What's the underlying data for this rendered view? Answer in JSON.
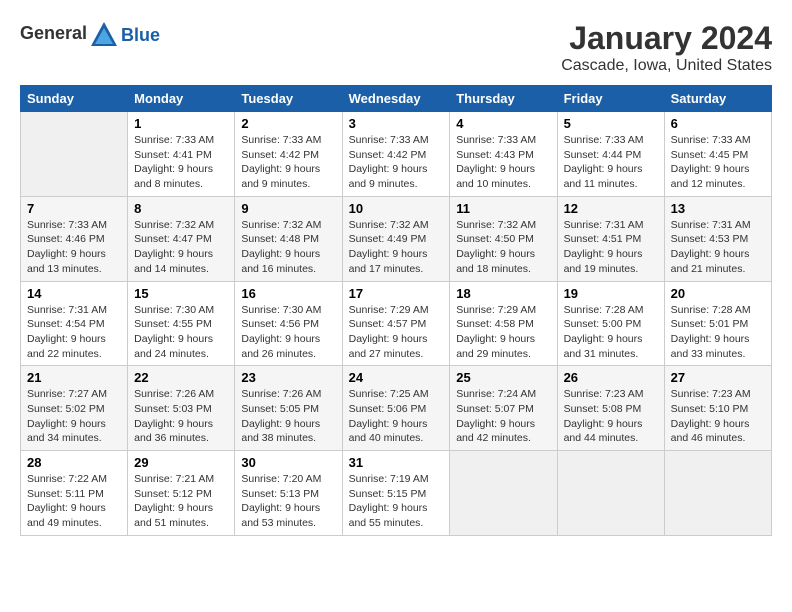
{
  "header": {
    "logo_general": "General",
    "logo_blue": "Blue",
    "month_year": "January 2024",
    "location": "Cascade, Iowa, United States"
  },
  "days_of_week": [
    "Sunday",
    "Monday",
    "Tuesday",
    "Wednesday",
    "Thursday",
    "Friday",
    "Saturday"
  ],
  "weeks": [
    [
      {
        "day": "",
        "info": ""
      },
      {
        "day": "1",
        "info": "Sunrise: 7:33 AM\nSunset: 4:41 PM\nDaylight: 9 hours\nand 8 minutes."
      },
      {
        "day": "2",
        "info": "Sunrise: 7:33 AM\nSunset: 4:42 PM\nDaylight: 9 hours\nand 9 minutes."
      },
      {
        "day": "3",
        "info": "Sunrise: 7:33 AM\nSunset: 4:42 PM\nDaylight: 9 hours\nand 9 minutes."
      },
      {
        "day": "4",
        "info": "Sunrise: 7:33 AM\nSunset: 4:43 PM\nDaylight: 9 hours\nand 10 minutes."
      },
      {
        "day": "5",
        "info": "Sunrise: 7:33 AM\nSunset: 4:44 PM\nDaylight: 9 hours\nand 11 minutes."
      },
      {
        "day": "6",
        "info": "Sunrise: 7:33 AM\nSunset: 4:45 PM\nDaylight: 9 hours\nand 12 minutes."
      }
    ],
    [
      {
        "day": "7",
        "info": "Sunrise: 7:33 AM\nSunset: 4:46 PM\nDaylight: 9 hours\nand 13 minutes."
      },
      {
        "day": "8",
        "info": "Sunrise: 7:32 AM\nSunset: 4:47 PM\nDaylight: 9 hours\nand 14 minutes."
      },
      {
        "day": "9",
        "info": "Sunrise: 7:32 AM\nSunset: 4:48 PM\nDaylight: 9 hours\nand 16 minutes."
      },
      {
        "day": "10",
        "info": "Sunrise: 7:32 AM\nSunset: 4:49 PM\nDaylight: 9 hours\nand 17 minutes."
      },
      {
        "day": "11",
        "info": "Sunrise: 7:32 AM\nSunset: 4:50 PM\nDaylight: 9 hours\nand 18 minutes."
      },
      {
        "day": "12",
        "info": "Sunrise: 7:31 AM\nSunset: 4:51 PM\nDaylight: 9 hours\nand 19 minutes."
      },
      {
        "day": "13",
        "info": "Sunrise: 7:31 AM\nSunset: 4:53 PM\nDaylight: 9 hours\nand 21 minutes."
      }
    ],
    [
      {
        "day": "14",
        "info": "Sunrise: 7:31 AM\nSunset: 4:54 PM\nDaylight: 9 hours\nand 22 minutes."
      },
      {
        "day": "15",
        "info": "Sunrise: 7:30 AM\nSunset: 4:55 PM\nDaylight: 9 hours\nand 24 minutes."
      },
      {
        "day": "16",
        "info": "Sunrise: 7:30 AM\nSunset: 4:56 PM\nDaylight: 9 hours\nand 26 minutes."
      },
      {
        "day": "17",
        "info": "Sunrise: 7:29 AM\nSunset: 4:57 PM\nDaylight: 9 hours\nand 27 minutes."
      },
      {
        "day": "18",
        "info": "Sunrise: 7:29 AM\nSunset: 4:58 PM\nDaylight: 9 hours\nand 29 minutes."
      },
      {
        "day": "19",
        "info": "Sunrise: 7:28 AM\nSunset: 5:00 PM\nDaylight: 9 hours\nand 31 minutes."
      },
      {
        "day": "20",
        "info": "Sunrise: 7:28 AM\nSunset: 5:01 PM\nDaylight: 9 hours\nand 33 minutes."
      }
    ],
    [
      {
        "day": "21",
        "info": "Sunrise: 7:27 AM\nSunset: 5:02 PM\nDaylight: 9 hours\nand 34 minutes."
      },
      {
        "day": "22",
        "info": "Sunrise: 7:26 AM\nSunset: 5:03 PM\nDaylight: 9 hours\nand 36 minutes."
      },
      {
        "day": "23",
        "info": "Sunrise: 7:26 AM\nSunset: 5:05 PM\nDaylight: 9 hours\nand 38 minutes."
      },
      {
        "day": "24",
        "info": "Sunrise: 7:25 AM\nSunset: 5:06 PM\nDaylight: 9 hours\nand 40 minutes."
      },
      {
        "day": "25",
        "info": "Sunrise: 7:24 AM\nSunset: 5:07 PM\nDaylight: 9 hours\nand 42 minutes."
      },
      {
        "day": "26",
        "info": "Sunrise: 7:23 AM\nSunset: 5:08 PM\nDaylight: 9 hours\nand 44 minutes."
      },
      {
        "day": "27",
        "info": "Sunrise: 7:23 AM\nSunset: 5:10 PM\nDaylight: 9 hours\nand 46 minutes."
      }
    ],
    [
      {
        "day": "28",
        "info": "Sunrise: 7:22 AM\nSunset: 5:11 PM\nDaylight: 9 hours\nand 49 minutes."
      },
      {
        "day": "29",
        "info": "Sunrise: 7:21 AM\nSunset: 5:12 PM\nDaylight: 9 hours\nand 51 minutes."
      },
      {
        "day": "30",
        "info": "Sunrise: 7:20 AM\nSunset: 5:13 PM\nDaylight: 9 hours\nand 53 minutes."
      },
      {
        "day": "31",
        "info": "Sunrise: 7:19 AM\nSunset: 5:15 PM\nDaylight: 9 hours\nand 55 minutes."
      },
      {
        "day": "",
        "info": ""
      },
      {
        "day": "",
        "info": ""
      },
      {
        "day": "",
        "info": ""
      }
    ]
  ]
}
